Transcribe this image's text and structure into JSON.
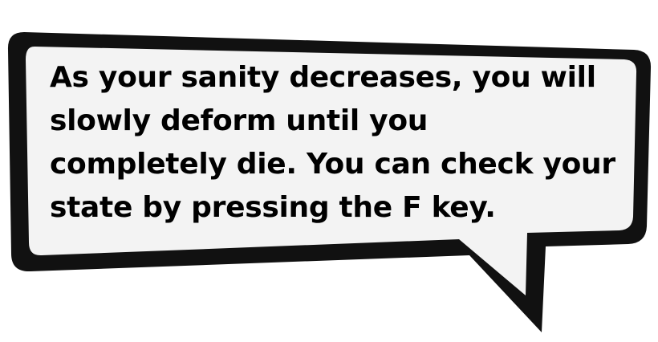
{
  "dialog": {
    "lines": [
      "As your sanity decreases, you will",
      "slowly deform until you",
      "completely die. You can check your",
      "state by pressing the F key."
    ]
  },
  "colors": {
    "bubble_fill": "#f3f3f3",
    "bubble_border": "#111111",
    "text": "#000000",
    "background": "#ffffff"
  }
}
